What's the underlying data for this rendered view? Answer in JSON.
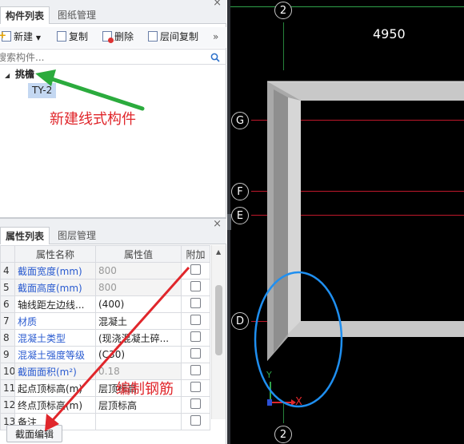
{
  "top_panel": {
    "tabs": [
      {
        "label": "构件列表",
        "active": true
      },
      {
        "label": "图纸管理",
        "active": false
      }
    ],
    "toolbar": {
      "new": "新建",
      "copy": "复制",
      "delete": "删除",
      "layer_copy": "层间复制",
      "more": "»"
    },
    "search": {
      "placeholder": "搜索构件..."
    },
    "tree": {
      "group": "挑檐",
      "item": "TY-2"
    }
  },
  "bottom_panel": {
    "tabs": [
      {
        "label": "属性列表",
        "active": true
      },
      {
        "label": "图层管理",
        "active": false
      }
    ],
    "headers": {
      "name": "属性名称",
      "value": "属性值",
      "extra": "附加"
    },
    "rows": [
      {
        "num": "4",
        "name": "截面宽度(mm)",
        "value": "800",
        "name_blue": true,
        "value_gray": true
      },
      {
        "num": "5",
        "name": "截面高度(mm)",
        "value": "800",
        "name_blue": true,
        "value_gray": true
      },
      {
        "num": "6",
        "name": "轴线距左边线...",
        "value": "(400)",
        "name_blue": false,
        "value_gray": false
      },
      {
        "num": "7",
        "name": "材质",
        "value": "混凝土",
        "name_blue": true,
        "value_gray": false
      },
      {
        "num": "8",
        "name": "混凝土类型",
        "value": "(现浇混凝土碎...",
        "name_blue": true,
        "value_gray": false
      },
      {
        "num": "9",
        "name": "混凝土强度等级",
        "value": "(C30)",
        "name_blue": true,
        "value_gray": false
      },
      {
        "num": "10",
        "name": "截面面积(m²)",
        "value": "0.18",
        "name_blue": true,
        "value_gray": true
      },
      {
        "num": "11",
        "name": "起点顶标高(m)",
        "value": "层顶标高",
        "name_blue": false,
        "value_gray": false
      },
      {
        "num": "12",
        "name": "终点顶标高(m)",
        "value": "层顶标高",
        "name_blue": false,
        "value_gray": false
      },
      {
        "num": "13",
        "name": "备注",
        "value": "",
        "name_blue": false,
        "value_gray": false
      }
    ],
    "section_edit_button": "截面编辑"
  },
  "annotations": {
    "new_line_component": "新建线式构件",
    "edit_rebar": "编制钢筋"
  },
  "cad": {
    "dimension": "4950",
    "axis_labels": {
      "top": "2",
      "bottom": "2",
      "g": "G",
      "f": "F",
      "e": "E",
      "d": "D"
    },
    "ucs": {
      "x": "X",
      "y": "Y"
    }
  },
  "colors": {
    "annotation_red": "#e0262b",
    "arrow_green": "#2bab3d",
    "ellipse_blue": "#1f8ff0",
    "grid_red": "#c0182b",
    "grid_green": "#2fa24a"
  }
}
